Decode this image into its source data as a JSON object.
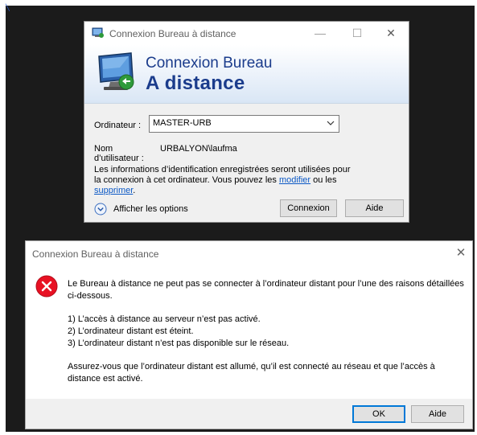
{
  "rdp_window": {
    "title": "Connexion Bureau à distance",
    "banner_line1": "Connexion Bureau",
    "banner_line2": "A distance",
    "computer_label": "Ordinateur :",
    "computer_value": "MASTER-URB",
    "username_label": "Nom d’utilisateur :",
    "username_value": "URBALYON\\laufma",
    "info_text_1": "Les informations d’identification enregistrées seront utilisées pour la connexion à cet ordinateur. Vous pouvez les ",
    "info_link_modify": "modifier",
    "info_text_2": " ou les ",
    "info_link_delete": "supprimer",
    "info_text_3": ".",
    "show_options_label": "Afficher les options",
    "connect_button": "Connexion",
    "help_button": "Aide"
  },
  "error_dialog": {
    "title": "Connexion Bureau à distance",
    "paragraph1": "Le Bureau à distance ne peut pas se connecter à l’ordinateur distant pour l’une des raisons détaillées ci-dessous.",
    "reasons": [
      "1) L’accès à distance au serveur n’est pas activé.",
      "2) L’ordinateur distant est éteint.",
      "3) L’ordinateur distant n’est pas disponible sur le réseau."
    ],
    "paragraph2": "Assurez-vous que l’ordinateur distant est allumé, qu’il est connecté au réseau et que l’accès à distance est activé.",
    "ok_button": "OK",
    "help_button": "Aide"
  },
  "icons": {
    "app": "rdp-app-icon",
    "banner": "rdp-monitor-icon",
    "error": "error-icon",
    "expand": "chevron-down-circle-icon"
  },
  "colors": {
    "banner_text": "#1b3c8c",
    "link": "#0b58c5",
    "error_red": "#e81123",
    "default_button_border": "#0078d7"
  }
}
